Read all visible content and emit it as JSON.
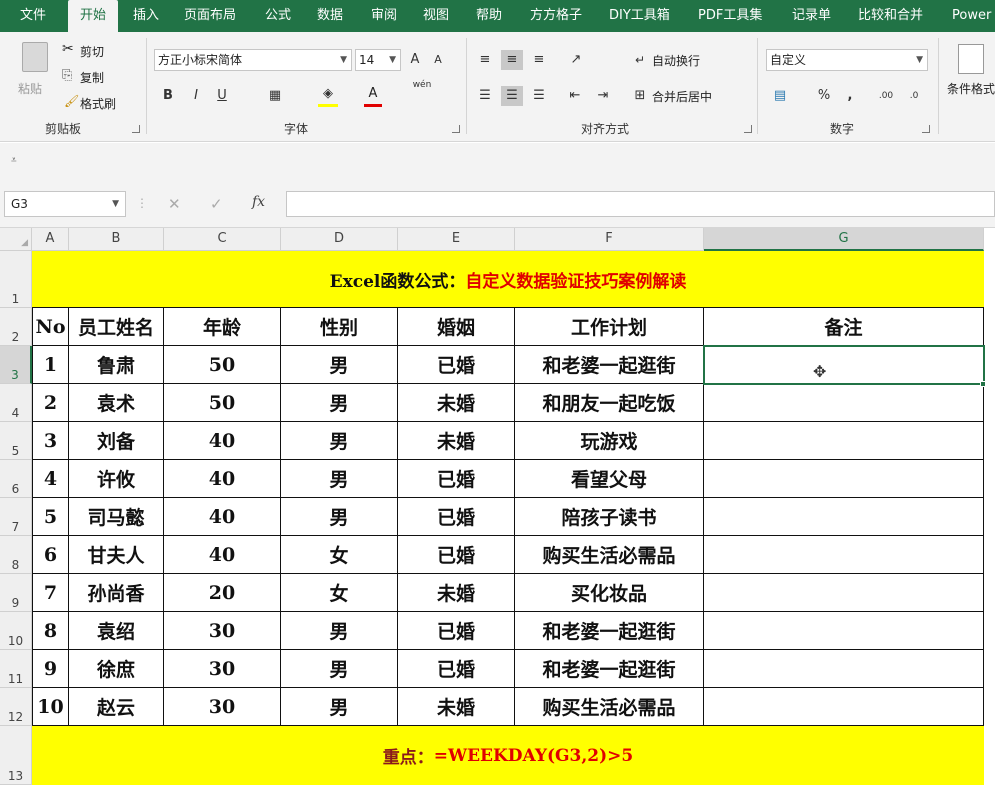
{
  "ribbon_tabs": [
    "文件",
    "开始",
    "插入",
    "页面布局",
    "公式",
    "数据",
    "审阅",
    "视图",
    "帮助",
    "方方格子",
    "DIY工具箱",
    "PDF工具集",
    "记录单",
    "比较和合并",
    "Power"
  ],
  "clipboard": {
    "paste": "粘贴",
    "cut": "剪切",
    "copy": "复制",
    "format_painter": "格式刷",
    "group": "剪贴板"
  },
  "font": {
    "name": "方正小标宋简体",
    "size": "14",
    "bold": "B",
    "italic": "I",
    "underline": "U",
    "phonetic": "wén",
    "group": "字体"
  },
  "alignment": {
    "wrap": "自动换行",
    "merge": "合并后居中",
    "group": "对齐方式"
  },
  "number": {
    "format": "自定义",
    "percent": "%",
    "comma": ",",
    "group": "数字"
  },
  "styles": {
    "conditional": "条件格式"
  },
  "formula_bar": {
    "cell_ref": "G3",
    "fx": "fx",
    "formula": ""
  },
  "sheet": {
    "columns": [
      "A",
      "B",
      "C",
      "D",
      "E",
      "F",
      "G"
    ],
    "rows": [
      "1",
      "2",
      "3",
      "4",
      "5",
      "6",
      "7",
      "8",
      "9",
      "10",
      "11",
      "12",
      "13"
    ],
    "title_black": "Excel函数公式：",
    "title_red": "自定义数据验证技巧案例解读",
    "headers": [
      "No",
      "员工姓名",
      "年龄",
      "性别",
      "婚姻",
      "工作计划",
      "备注"
    ],
    "data": [
      [
        "1",
        "鲁肃",
        "50",
        "男",
        "已婚",
        "和老婆一起逛街",
        ""
      ],
      [
        "2",
        "袁术",
        "50",
        "男",
        "未婚",
        "和朋友一起吃饭",
        ""
      ],
      [
        "3",
        "刘备",
        "40",
        "男",
        "未婚",
        "玩游戏",
        ""
      ],
      [
        "4",
        "许攸",
        "40",
        "男",
        "已婚",
        "看望父母",
        ""
      ],
      [
        "5",
        "司马懿",
        "40",
        "男",
        "已婚",
        "陪孩子读书",
        ""
      ],
      [
        "6",
        "甘夫人",
        "40",
        "女",
        "已婚",
        "购买生活必需品",
        ""
      ],
      [
        "7",
        "孙尚香",
        "20",
        "女",
        "未婚",
        "买化妆品",
        ""
      ],
      [
        "8",
        "袁绍",
        "30",
        "男",
        "已婚",
        "和老婆一起逛街",
        ""
      ],
      [
        "9",
        "徐庶",
        "30",
        "男",
        "已婚",
        "和老婆一起逛街",
        ""
      ],
      [
        "10",
        "赵云",
        "30",
        "男",
        "未婚",
        "购买生活必需品",
        ""
      ]
    ],
    "footer_black": "重点：",
    "footer_red": "=WEEKDAY(G3,2)>5"
  },
  "colors": {
    "accent": "#217346",
    "highlight": "#ffff00",
    "emphasis": "#e00000"
  }
}
